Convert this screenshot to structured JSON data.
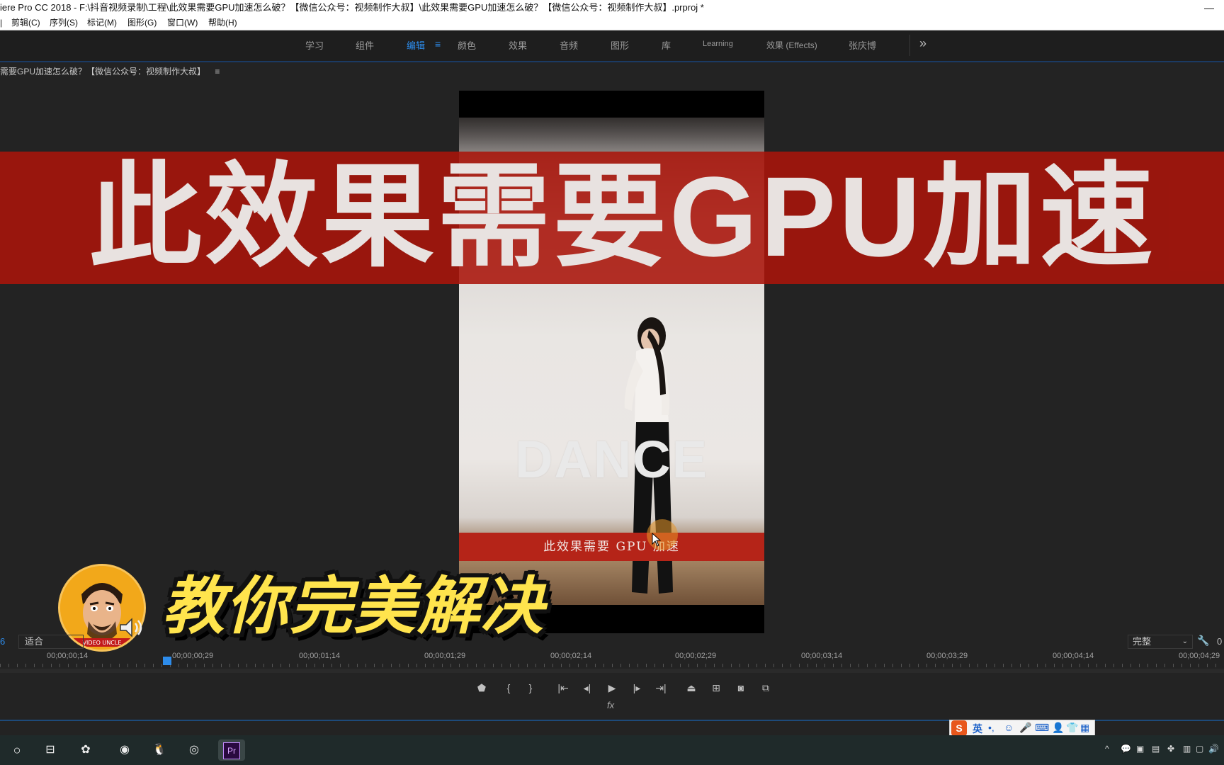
{
  "window": {
    "title": "iere Pro CC 2018 - F:\\抖音视频录制\\工程\\此效果需要GPU加速怎么破？【微信公众号：视频制作大叔】\\此效果需要GPU加速怎么破？【微信公众号：视频制作大叔】.prproj *",
    "minimize": "—"
  },
  "menu": [
    "剪辑(C)",
    "序列(S)",
    "标记(M)",
    "图形(G)",
    "窗口(W)",
    "帮助(H)"
  ],
  "workspaces": {
    "items": [
      "学习",
      "组件",
      "编辑",
      "颜色",
      "效果",
      "音频",
      "图形",
      "库",
      "Learning",
      "效果 (Effects)",
      "张庆博"
    ],
    "active": "编辑",
    "more": "»"
  },
  "sequence": {
    "title": "需要GPU加速怎么破？【微信公众号：视频制作大叔】",
    "menu_icon": "≡"
  },
  "monitor": {
    "video_text": "DANCE",
    "lower_third": "此效果需要 GPU 加速"
  },
  "overlay": {
    "banner": "此效果需要GPU加速",
    "caption": "教你完美解决",
    "avatar_text": "VIDEO UNCLE"
  },
  "controls": {
    "left_number": "6",
    "fit": "适合",
    "resolution": "完整",
    "right_number": "0",
    "ruler": [
      "00;00;00;14",
      "00;00;00;29",
      "00;00;01;14",
      "00;00;01;29",
      "00;00;02;14",
      "00;00;02;29",
      "00;00;03;14",
      "00;00;03;29",
      "00;00;04;14",
      "00;00;04;29"
    ],
    "fx": "fx"
  },
  "ime": {
    "lang": "英"
  },
  "icons": {
    "marker": "marker-icon",
    "in": "mark-in-icon",
    "out": "mark-out-icon",
    "goto_in": "go-to-in-icon",
    "step_back": "step-back-icon",
    "play": "play-icon",
    "step_forward": "step-forward-icon",
    "goto_out": "go-to-out-icon",
    "lift": "lift-icon",
    "extract": "extract-icon",
    "export_frame": "camera-icon",
    "compare": "compare-icon"
  },
  "colors": {
    "accent": "#2d8ceb",
    "banner": "#aa140a",
    "caption": "#ffe44d",
    "lower_third": "#b52418"
  }
}
